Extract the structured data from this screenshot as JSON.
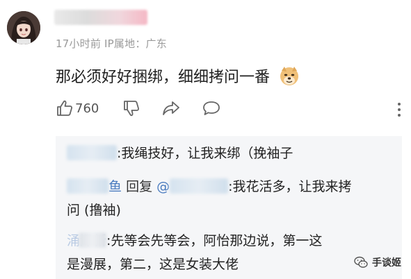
{
  "comment": {
    "meta": "17小时前 IP属地：广东",
    "text": "那必须好好捆绑，细细拷问一番",
    "emoji": "doge-emoji",
    "like_count": "760"
  },
  "icons": {
    "like": "thumb-up-icon",
    "dislike": "thumb-down-icon",
    "share": "share-icon",
    "reply": "comment-bubble-icon",
    "more": "more-vertical-icon"
  },
  "replies": [
    {
      "name_tail": "",
      "text": ":我绳技好，让我来绑（挽袖子"
    },
    {
      "name_tail": "鱼",
      "reply_word": "回复",
      "at": "@",
      "text": ":我花活多，让我来拷",
      "text2": "问 (撸袖)"
    },
    {
      "name_tail": "涌泽新",
      "text": ":先等会先等会，阿怡那边说，第一这",
      "text2": "是漫展，第二，这是女装大佬"
    }
  ],
  "watermark": {
    "text": "手谈姬"
  }
}
